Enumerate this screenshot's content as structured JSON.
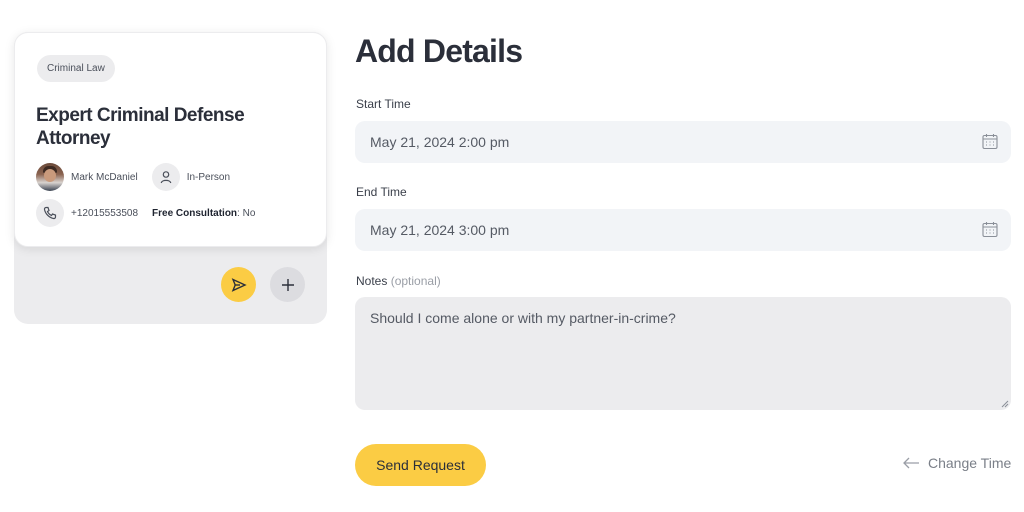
{
  "card": {
    "tag": "Criminal Law",
    "title": "Expert Criminal Defense Attorney",
    "lawyer_name": "Mark McDaniel",
    "meeting_type": "In-Person",
    "phone": "+12015553508",
    "consultation_label": "Free Consultation",
    "consultation_value": ": No",
    "icons": {
      "phone": "phone-icon",
      "person": "person-icon",
      "send": "send-icon",
      "add": "plus-icon"
    }
  },
  "form": {
    "title": "Add Details",
    "start_label": "Start Time",
    "start_value": "May 21, 2024 2:00 pm",
    "end_label": "End Time",
    "end_value": "May 21, 2024 3:00 pm",
    "notes_label": "Notes",
    "notes_optional": "(optional)",
    "notes_value": "Should I come alone or with my partner-in-crime?",
    "submit_label": "Send Request",
    "change_time_label": "Change Time"
  },
  "colors": {
    "accent": "#fbcc44",
    "input_bg": "#f2f4f7",
    "card_bg": "#ececee",
    "text_dark": "#2b2f3a"
  }
}
